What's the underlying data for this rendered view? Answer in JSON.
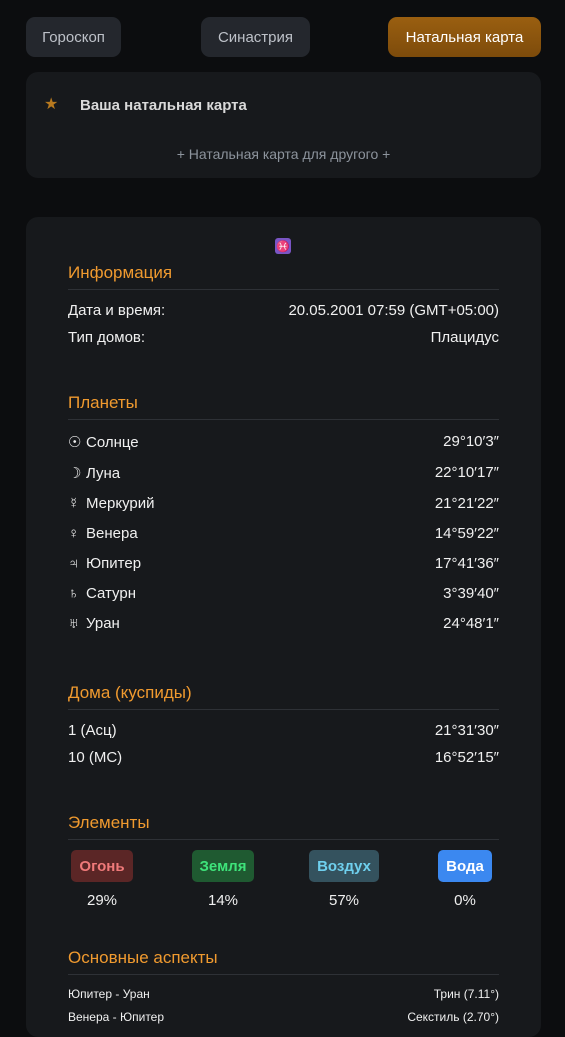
{
  "nav": {
    "horoscope": "Гороскоп",
    "synastry": "Синастрия",
    "natal": "Натальная карта"
  },
  "my_chart": {
    "icon": "star-icon",
    "title": "Ваша натальная карта",
    "other_link": "+ Натальная карта для другого +"
  },
  "sign_glyph": "♓",
  "info": {
    "title": "Информация",
    "rows": [
      {
        "label": "Дата и время:",
        "value": "20.05.2001 07:59 (GMT+05:00)"
      },
      {
        "label": "Тип домов:",
        "value": "Плацидус"
      }
    ]
  },
  "planets": {
    "title": "Планеты",
    "rows": [
      {
        "glyph": "☉",
        "name": "Солнце",
        "value": "29°10′3″"
      },
      {
        "glyph": "☽",
        "name": "Луна",
        "value": "22°10′17″"
      },
      {
        "glyph": "☿",
        "name": "Меркурий",
        "value": "21°21′22″"
      },
      {
        "glyph": "♀",
        "name": "Венера",
        "value": "14°59′22″"
      },
      {
        "glyph": "♃",
        "name": "Юпитер",
        "value": "17°41′36″"
      },
      {
        "glyph": "♄",
        "name": "Сатурн",
        "value": "3°39′40″"
      },
      {
        "glyph": "♅",
        "name": "Уран",
        "value": "24°48′1″"
      }
    ]
  },
  "houses": {
    "title": "Дома (куспиды)",
    "rows": [
      {
        "label": "1 (Асц)",
        "value": "21°31′30″"
      },
      {
        "label": "10 (MC)",
        "value": "16°52′15″"
      }
    ]
  },
  "elements": {
    "title": "Элементы",
    "items": [
      {
        "label": "Огонь",
        "pct": "29%",
        "bg": "#5b2626",
        "color": "#f07a7a"
      },
      {
        "label": "Земля",
        "pct": "14%",
        "bg": "#1f5a31",
        "color": "#3ee37a"
      },
      {
        "label": "Воздух",
        "pct": "57%",
        "bg": "#34525e",
        "color": "#6fd0ee"
      },
      {
        "label": "Вода",
        "pct": "0%",
        "bg": "#3b88f0",
        "color": "#ffffff"
      }
    ]
  },
  "aspects": {
    "title": "Основные аспекты",
    "rows": [
      {
        "pair": "Юпитер - Уран",
        "type": "Трин (7.11°)"
      },
      {
        "pair": "Венера - Юпитер",
        "type": "Секстиль (2.70°)"
      }
    ]
  }
}
